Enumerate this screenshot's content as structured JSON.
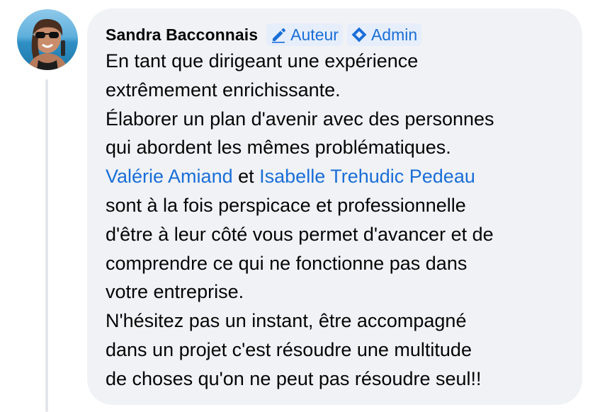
{
  "comment": {
    "author": "Sandra Bacconnais",
    "badges": {
      "author_label": "Auteur",
      "author_icon": "pencil-icon",
      "admin_label": "Admin",
      "admin_icon": "admin-diamond-icon"
    },
    "lines": {
      "l1": "En tant que dirigeant une expérience",
      "l2": "extrêmement enrichissante.",
      "l3": "Élaborer un plan d'avenir avec des personnes",
      "l4": "qui abordent les mêmes problématiques.",
      "mention1": "Valérie Amiand",
      "connector": " et ",
      "mention2": "Isabelle Trehudic Pedeau",
      "l6": "sont à la fois perspicace et professionnelle",
      "l7": "d'être à leur côté vous permet d'avancer et de",
      "l8": "comprendre ce qui ne fonctionne pas dans",
      "l9": "votre entreprise.",
      "l10": "N'hésitez pas un instant, être accompagné",
      "l11": "dans un projet c'est résoudre une multitude",
      "l12": "de choses qu'on ne peut pas résoudre seul!!"
    }
  },
  "colors": {
    "bubble_bg": "#f0f2f5",
    "link_blue": "#1a6ed8",
    "text": "#050505",
    "thread_line": "#e4e6eb"
  }
}
